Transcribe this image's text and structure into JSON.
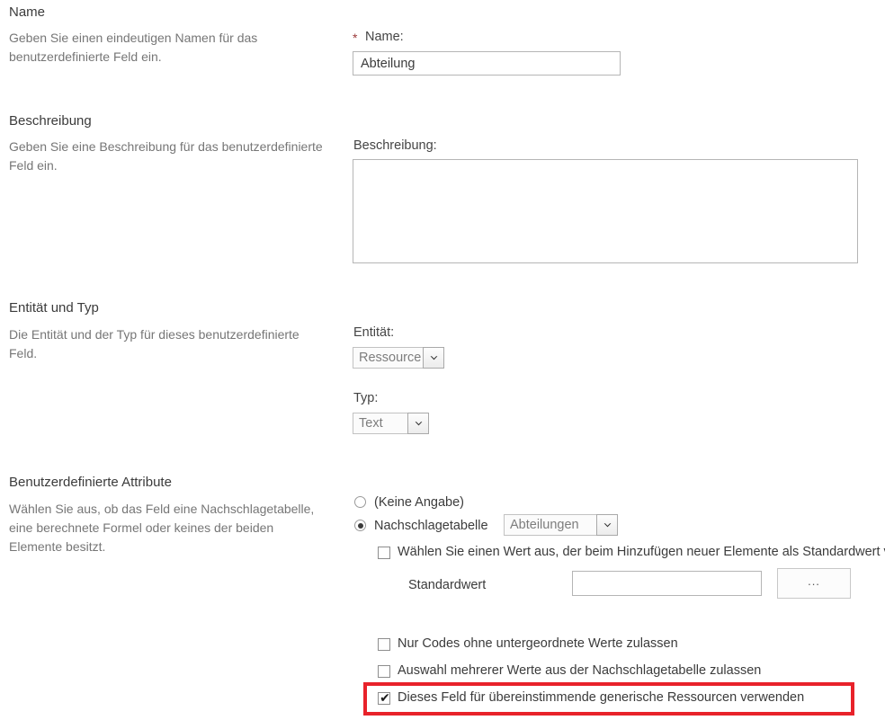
{
  "sections": [
    {
      "title": "Name",
      "description": "Geben Sie einen eindeutigen Namen für das benutzerdefinierte Feld ein."
    },
    {
      "title": "Beschreibung",
      "description": "Geben Sie eine Beschreibung für das benutzerdefinierte Feld ein."
    },
    {
      "title": "Entität und Typ",
      "description": "Die Entität und der Typ für dieses benutzerdefinierte Feld."
    },
    {
      "title": "Benutzerdefinierte Attribute",
      "description": "Wählen Sie aus, ob das Feld eine Nachschlagetabelle, eine berechnete Formel oder keines der beiden Elemente besitzt."
    }
  ],
  "name_field": {
    "required_marker": "*",
    "label": "Name:",
    "value": "Abteilung",
    "placeholder": ""
  },
  "description_field": {
    "label": "Beschreibung:",
    "value": "",
    "placeholder": ""
  },
  "entity_field": {
    "label": "Entität:",
    "selected": "Ressource",
    "options": [
      "Ressource"
    ]
  },
  "type_field": {
    "label": "Typ:",
    "selected": "Text",
    "options": [
      "Text"
    ]
  },
  "attributes": {
    "radio_none": {
      "label": "(Keine Angabe)",
      "checked": false
    },
    "radio_lookup": {
      "label": "Nachschlagetabelle",
      "checked": true
    },
    "lookup_table": {
      "selected": "Abteilungen",
      "options": [
        "Abteilungen"
      ]
    },
    "default_value_checkbox": {
      "label": "Wählen Sie einen Wert aus, der beim Hinzufügen neuer Elemente als Standardwert verwendet wird",
      "checked": false
    },
    "default_value_label": "Standardwert",
    "default_value_input": {
      "value": "",
      "placeholder": ""
    },
    "browse_button_label": "...",
    "checkboxes": [
      {
        "label": "Nur Codes ohne untergeordnete Werte zulassen",
        "checked": false,
        "highlighted": false
      },
      {
        "label": "Auswahl mehrerer Werte aus der Nachschlagetabelle zulassen",
        "checked": false,
        "highlighted": false
      },
      {
        "label": "Dieses Feld für übereinstimmende generische Ressourcen verwenden",
        "checked": true,
        "highlighted": true
      }
    ]
  },
  "colors": {
    "highlight": "#e8222a",
    "required_marker": "#9b3a3a",
    "section_title": "#3b3b3b",
    "section_description": "#767676",
    "field_border": "#b5b5b5"
  },
  "icons": {
    "dropdown": "chevron-down-icon",
    "checkmark": "✔"
  }
}
